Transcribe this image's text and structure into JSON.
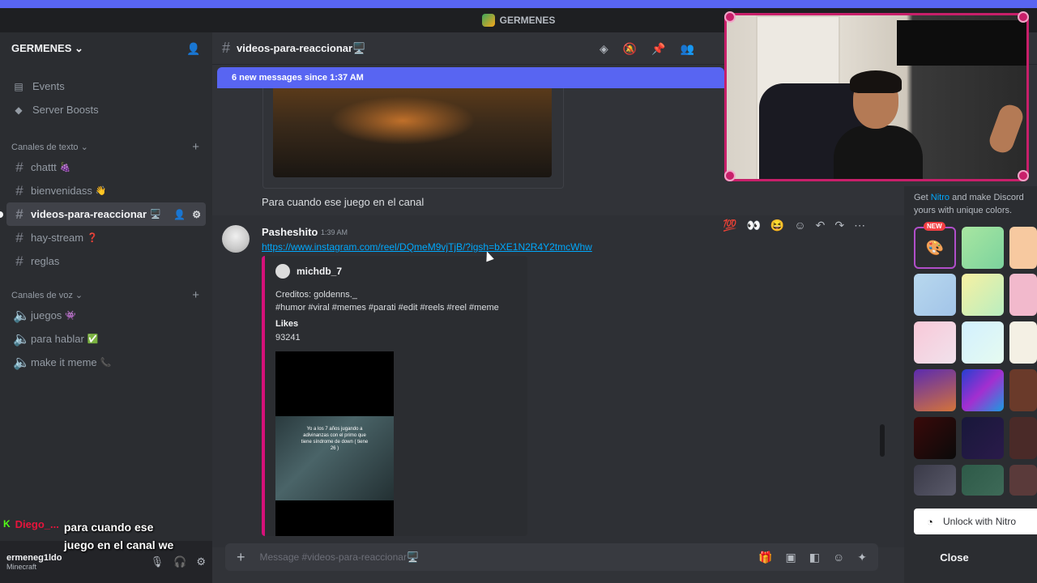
{
  "window": {
    "title": "GERMENES"
  },
  "server": {
    "name": "GERMENES",
    "caret": "⌄"
  },
  "sidebar": {
    "links": [
      {
        "label": "Events",
        "icon": "calendar-icon"
      },
      {
        "label": "Server Boosts",
        "icon": "boost-icon"
      }
    ],
    "text_category": "Canales de texto",
    "text_channels": [
      {
        "label": "chattt",
        "emoji": "🍇"
      },
      {
        "label": "bienvenidass",
        "emoji": "👋"
      },
      {
        "label": "videos-para-reaccionar",
        "emoji": "🖥️"
      },
      {
        "label": "hay-stream",
        "emoji": "❓"
      },
      {
        "label": "reglas",
        "emoji": ""
      }
    ],
    "voice_category": "Canales de voz",
    "voice_channels": [
      {
        "label": "juegos",
        "emoji": "👾"
      },
      {
        "label": "para hablar",
        "emoji": "✅"
      },
      {
        "label": "make it meme",
        "emoji": "📞"
      }
    ]
  },
  "user_panel": {
    "name": "ermeneg1ldo",
    "status": "Minecraft"
  },
  "stream_chat": {
    "platform_badge": "K",
    "username": "Diego_...",
    "message": "para cuando ese juego en el canal we"
  },
  "channel": {
    "name": "videos-para-reaccionar🖥️",
    "new_messages_banner": "6 new messages since 1:37 AM"
  },
  "messages": {
    "previous_text": "Para cuando ese juego en el canal",
    "author": "Pasheshito",
    "time": "1:39 AM",
    "link": "https://www.instagram.com/reel/DQmeM9vjTjB/?igsh=bXE1N2R4Y2tmcWhw",
    "embed": {
      "author": "michdb_7",
      "desc_line1": "Creditos: goldenns._",
      "desc_line2": "#humor #viral #memes #parati #edit #reels #reel #meme",
      "field_name": "Likes",
      "field_value": "93241",
      "video_caption": "Yo a los 7 años jugando a adivinanzas con el primo que tiene síndrome de down ( tiene 26 )"
    }
  },
  "composer": {
    "placeholder": "Message #videos-para-reaccionar🖥️"
  },
  "nitro_panel": {
    "promo_text_1": "Get ",
    "promo_link": "Nitro",
    "promo_text_2": " and make Discord yours with unique colors.",
    "new_badge": "NEW",
    "unlock_label": "Unlock with Nitro",
    "close_label": "Close"
  },
  "colors": {
    "accent": "#5865f2",
    "embed_bar": "#d6117a",
    "link": "#00a8fc",
    "webcam_border": "#c81f6a"
  }
}
